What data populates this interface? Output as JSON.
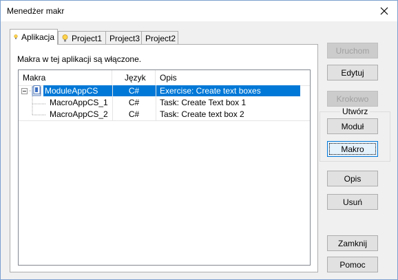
{
  "window": {
    "title": "Menedżer makr"
  },
  "tabs": [
    {
      "label": "Aplikacja",
      "icon": "lightbulb-icon"
    },
    {
      "label": "Project1",
      "icon": "lightbulb-icon"
    },
    {
      "label": "Project3"
    },
    {
      "label": "Project2"
    }
  ],
  "panel": {
    "info": "Makra w tej aplikacji są włączone."
  },
  "list": {
    "columns": [
      "Makra",
      "Język",
      "Opis"
    ],
    "rows": [
      {
        "name": "ModuleAppCS",
        "lang": "C#",
        "desc": "Exercise: Create text boxes",
        "selected": true
      },
      {
        "name": "MacroAppCS_1",
        "lang": "C#",
        "desc": "Task: Create Text box 1"
      },
      {
        "name": "MacroAppCS_2",
        "lang": "C#",
        "desc": "Task: Create text box 2"
      }
    ]
  },
  "buttons": {
    "run": "Uruchom",
    "edit": "Edytuj",
    "step": "Krokowo",
    "create_group": "Utwórz",
    "module": "Moduł",
    "macro": "Makro",
    "description": "Opis",
    "delete": "Usuń",
    "close": "Zamknij",
    "help": "Pomoc"
  },
  "colors": {
    "selection": "#0078d7",
    "focus": "#0078d7"
  }
}
